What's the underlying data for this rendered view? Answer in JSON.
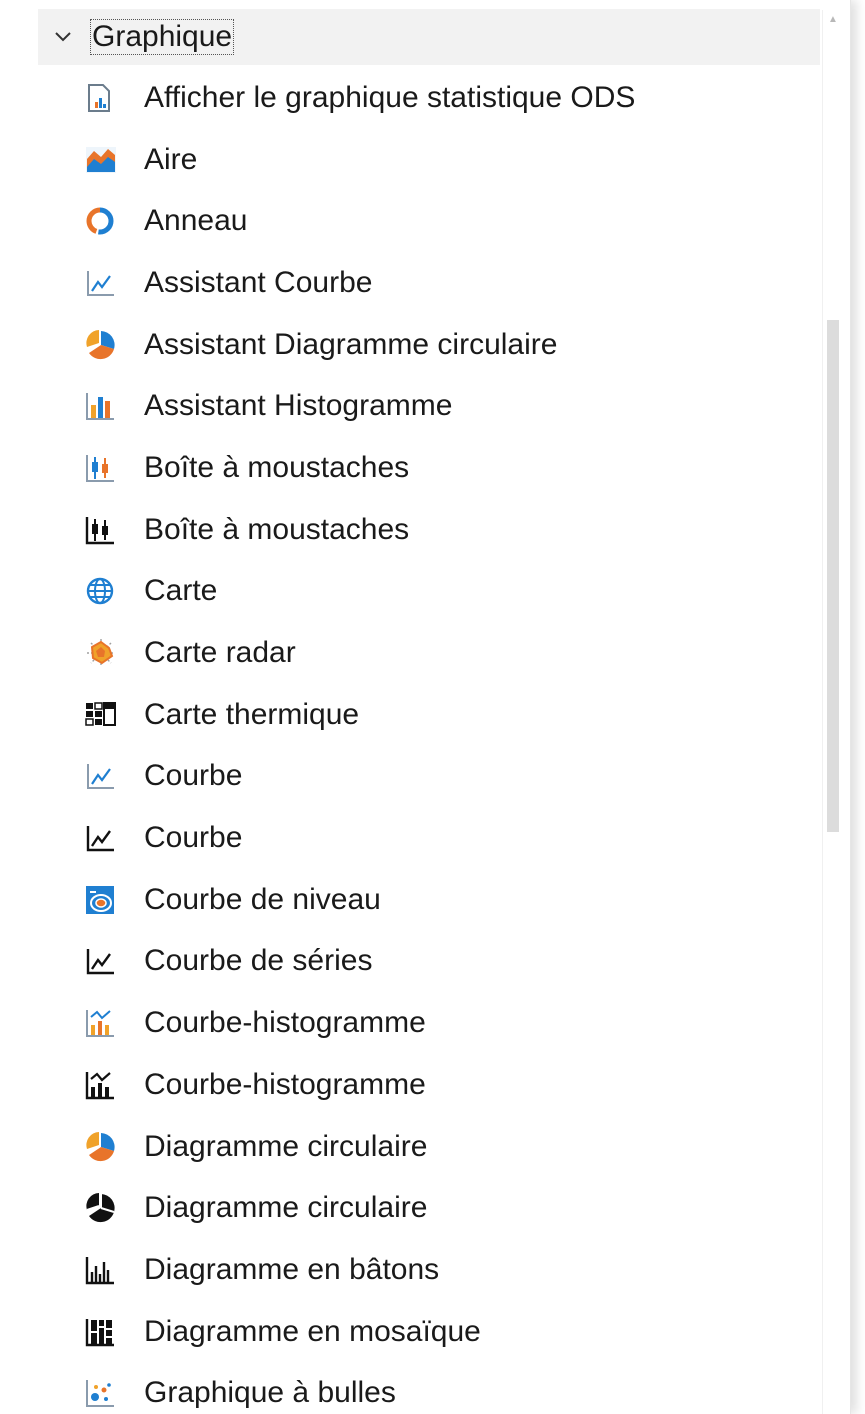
{
  "header": {
    "label": "Graphique",
    "expanded_icon": "chevron-down-icon"
  },
  "items": [
    {
      "label": "Afficher le graphique statistique ODS",
      "icon": "ods-graph-icon"
    },
    {
      "label": "Aire",
      "icon": "area-chart-icon"
    },
    {
      "label": "Anneau",
      "icon": "donut-chart-icon"
    },
    {
      "label": "Assistant Courbe",
      "icon": "line-chart-light-icon"
    },
    {
      "label": "Assistant Diagramme circulaire",
      "icon": "pie-chart-color-icon"
    },
    {
      "label": "Assistant Histogramme",
      "icon": "histogram-color-icon"
    },
    {
      "label": "Boîte à moustaches",
      "icon": "box-plot-color-icon"
    },
    {
      "label": "Boîte à moustaches",
      "icon": "box-plot-black-icon"
    },
    {
      "label": "Carte",
      "icon": "globe-icon"
    },
    {
      "label": "Carte radar",
      "icon": "radar-chart-icon"
    },
    {
      "label": "Carte thermique",
      "icon": "heatmap-icon"
    },
    {
      "label": "Courbe",
      "icon": "line-chart-light-icon"
    },
    {
      "label": "Courbe",
      "icon": "line-chart-black-icon"
    },
    {
      "label": "Courbe de niveau",
      "icon": "contour-plot-icon"
    },
    {
      "label": "Courbe de séries",
      "icon": "series-line-chart-icon"
    },
    {
      "label": "Courbe-histogramme",
      "icon": "line-bar-chart-color-icon"
    },
    {
      "label": "Courbe-histogramme",
      "icon": "line-bar-chart-black-icon"
    },
    {
      "label": "Diagramme circulaire",
      "icon": "pie-chart-color-icon"
    },
    {
      "label": "Diagramme circulaire",
      "icon": "pie-chart-black-icon"
    },
    {
      "label": "Diagramme en bâtons",
      "icon": "needle-chart-icon"
    },
    {
      "label": "Diagramme en mosaïque",
      "icon": "mosaic-chart-icon"
    },
    {
      "label": "Graphique à bulles",
      "icon": "bubble-chart-icon"
    }
  ],
  "colors": {
    "accent_blue": "#1f7fd1",
    "accent_orange": "#e8742a",
    "header_bg": "#f2f2f2",
    "scroll_thumb": "#dcdcdc"
  }
}
